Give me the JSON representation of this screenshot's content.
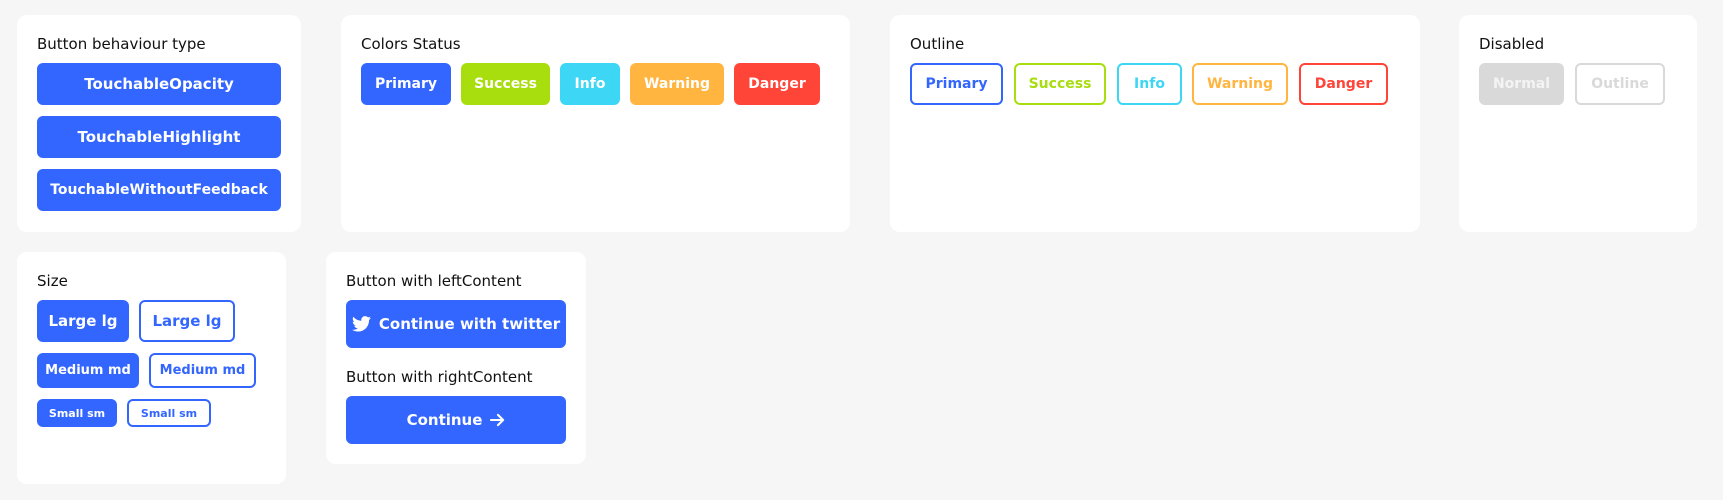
{
  "behaviour": {
    "title": "Button behaviour type",
    "buttons": [
      "TouchableOpacity",
      "TouchableHighlight",
      "TouchableWithoutFeedback"
    ]
  },
  "colors": {
    "title": "Colors Status",
    "buttons": [
      "Primary",
      "Success",
      "Info",
      "Warning",
      "Danger"
    ]
  },
  "outline": {
    "title": "Outline",
    "buttons": [
      "Primary",
      "Success",
      "Info",
      "Warning",
      "Danger"
    ]
  },
  "disabled": {
    "title": "Disabled",
    "buttons": [
      "Normal",
      "Outline"
    ]
  },
  "size": {
    "title": "Size",
    "buttons": [
      "Large lg",
      "Large lg",
      "Medium md",
      "Medium md",
      "Small sm",
      "Small sm"
    ]
  },
  "content": {
    "left_title": "Button with leftContent",
    "left_button": "Continue with twitter",
    "left_icon": "twitter-icon",
    "right_title": "Button with rightContent",
    "right_button": "Continue",
    "right_icon": "arrow-right-icon"
  },
  "palette": {
    "primary": "#3366ff",
    "success": "#a8dd0e",
    "info": "#3dd7f5",
    "warning": "#ffb540",
    "danger": "#ff4438",
    "disabled": "#d9d9d9"
  }
}
